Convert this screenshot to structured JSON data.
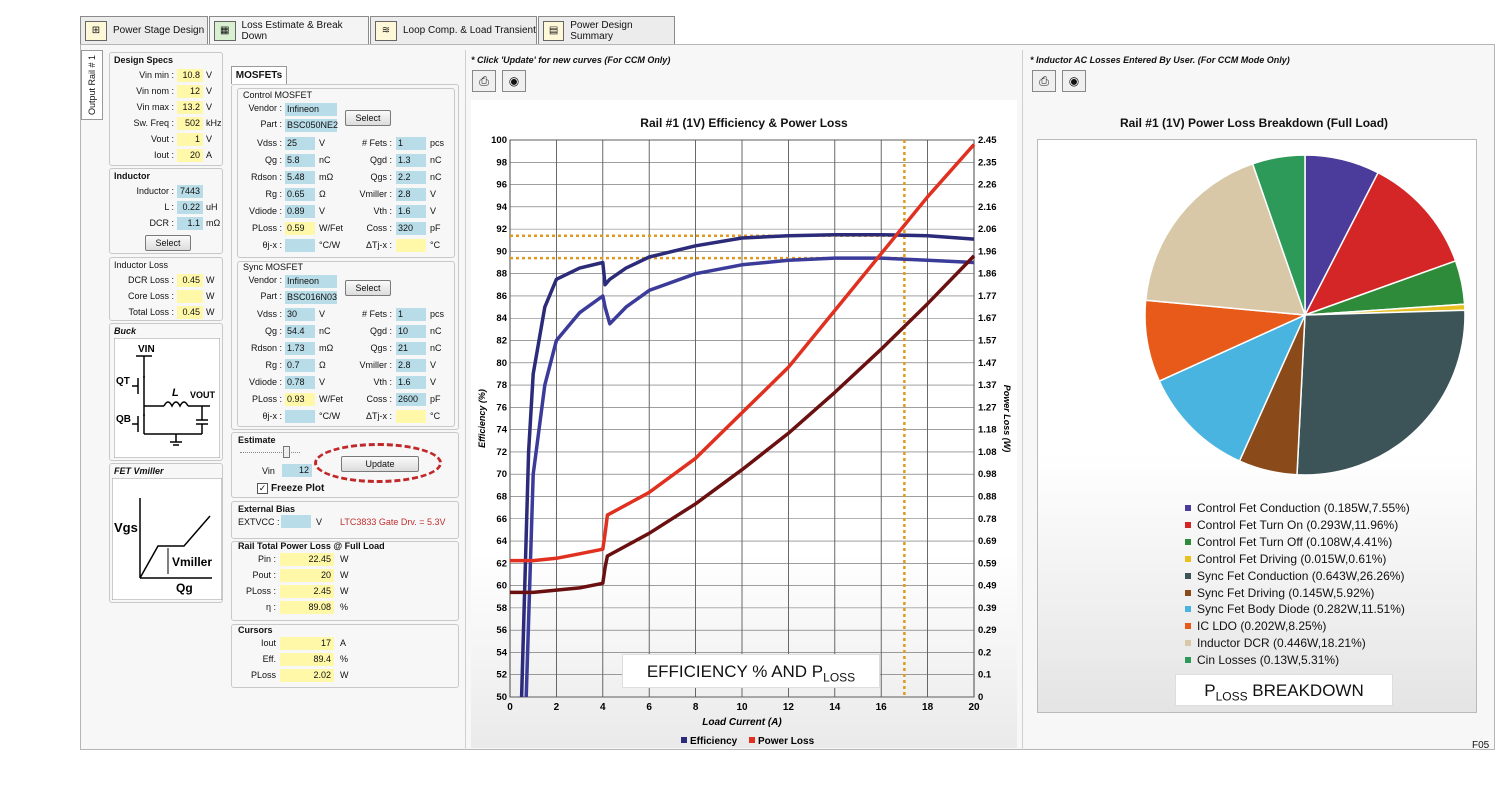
{
  "tabs": [
    {
      "label": "Power Stage Design",
      "icon": "power-stage-icon"
    },
    {
      "label": "Loss Estimate & Break Down",
      "icon": "loss-estimate-icon"
    },
    {
      "label": "Loop Comp. & Load Transient",
      "icon": "loop-comp-icon"
    },
    {
      "label": "Power Design Summary",
      "icon": "summary-icon"
    }
  ],
  "side_tab": "Output Rail # 1",
  "design_specs": {
    "title": "Design Specs",
    "rows": [
      {
        "label": "Vin min :",
        "value": "10.8",
        "unit": "V"
      },
      {
        "label": "Vin nom :",
        "value": "12",
        "unit": "V"
      },
      {
        "label": "Vin max :",
        "value": "13.2",
        "unit": "V"
      },
      {
        "label": "Sw. Freq :",
        "value": "502",
        "unit": "kHz"
      },
      {
        "label": "Vout :",
        "value": "1",
        "unit": "V"
      },
      {
        "label": "Iout :",
        "value": "20",
        "unit": "A"
      }
    ]
  },
  "inductor": {
    "title": "Inductor",
    "rows": [
      {
        "label": "Inductor :",
        "value": "7443",
        "unit": ""
      },
      {
        "label": "L :",
        "value": "0.22",
        "unit": "uH"
      },
      {
        "label": "DCR :",
        "value": "1.1",
        "unit": "mΩ"
      }
    ],
    "select_label": "Select"
  },
  "inductor_loss": {
    "title": "Inductor Loss",
    "rows": [
      {
        "label": "DCR Loss :",
        "value": "0.45",
        "unit": "W"
      },
      {
        "label": "Core Loss :",
        "value": "",
        "unit": "W"
      },
      {
        "label": "Total Loss :",
        "value": "0.45",
        "unit": "W"
      }
    ]
  },
  "buck": {
    "title": "Buck",
    "vin": "VIN",
    "qt": "QT",
    "qb": "QB",
    "l": "L",
    "vout": "VOUT"
  },
  "fet_vmiller": {
    "title": "FET Vmiller",
    "vgs": "Vgs",
    "vmiller": "Vmiller",
    "qg": "Qg"
  },
  "mosfets": {
    "tab_label": "MOSFETs",
    "control": {
      "title": "Control MOSFET",
      "vendor": "Infineon",
      "part": "BSC050NE2",
      "select_label": "Select",
      "vendor_label": "Vendor :",
      "part_label": "Part :",
      "left": [
        {
          "label": "Vdss :",
          "value": "25",
          "unit": "V"
        },
        {
          "label": "Qg :",
          "value": "5.8",
          "unit": "nC"
        },
        {
          "label": "Rdson :",
          "value": "5.48",
          "unit": "mΩ"
        },
        {
          "label": "Rg :",
          "value": "0.65",
          "unit": "Ω"
        },
        {
          "label": "Vdiode :",
          "value": "0.89",
          "unit": "V"
        },
        {
          "label": "PLoss :",
          "value": "0.59",
          "unit": "W/Fet"
        },
        {
          "label": "θj-x :",
          "value": "",
          "unit": "°C/W"
        }
      ],
      "right": [
        {
          "label": "# Fets :",
          "value": "1",
          "unit": "pcs"
        },
        {
          "label": "Qgd :",
          "value": "1.3",
          "unit": "nC"
        },
        {
          "label": "Qgs :",
          "value": "2.2",
          "unit": "nC"
        },
        {
          "label": "Vmiller :",
          "value": "2.8",
          "unit": "V"
        },
        {
          "label": "Vth :",
          "value": "1.6",
          "unit": "V"
        },
        {
          "label": "Coss :",
          "value": "320",
          "unit": "pF"
        },
        {
          "label": "ΔTj-x :",
          "value": "",
          "unit": "°C"
        }
      ]
    },
    "sync": {
      "title": "Sync MOSFET",
      "vendor": "Infineon",
      "part": "BSC016N03",
      "select_label": "Select",
      "vendor_label": "Vendor :",
      "part_label": "Part :",
      "left": [
        {
          "label": "Vdss :",
          "value": "30",
          "unit": "V"
        },
        {
          "label": "Qg :",
          "value": "54.4",
          "unit": "nC"
        },
        {
          "label": "Rdson :",
          "value": "1.73",
          "unit": "mΩ"
        },
        {
          "label": "Rg :",
          "value": "0.7",
          "unit": "Ω"
        },
        {
          "label": "Vdiode :",
          "value": "0.78",
          "unit": "V"
        },
        {
          "label": "PLoss :",
          "value": "0.93",
          "unit": "W/Fet"
        },
        {
          "label": "θj-x :",
          "value": "",
          "unit": "°C/W"
        }
      ],
      "right": [
        {
          "label": "# Fets :",
          "value": "1",
          "unit": "pcs"
        },
        {
          "label": "Qgd :",
          "value": "10",
          "unit": "nC"
        },
        {
          "label": "Qgs :",
          "value": "21",
          "unit": "nC"
        },
        {
          "label": "Vmiller :",
          "value": "2.8",
          "unit": "V"
        },
        {
          "label": "Vth :",
          "value": "1.6",
          "unit": "V"
        },
        {
          "label": "Coss :",
          "value": "2600",
          "unit": "pF"
        },
        {
          "label": "ΔTj-x :",
          "value": "",
          "unit": "°C"
        }
      ]
    }
  },
  "estimate": {
    "title": "Estimate",
    "vin_label": "Vin",
    "vin_value": "12",
    "update_label": "Update",
    "freeze_label": "Freeze Plot",
    "freeze_checked": true
  },
  "external_bias": {
    "title": "External Bias",
    "extvcc_label": "EXTVCC :",
    "extvcc_value": "",
    "unit": "V",
    "note": "LTC3833 Gate Drv. = 5.3V"
  },
  "rail_total": {
    "title": "Rail Total Power Loss @ Full Load",
    "rows": [
      {
        "label": "Pin :",
        "value": "22.45",
        "unit": "W"
      },
      {
        "label": "Pout :",
        "value": "20",
        "unit": "W"
      },
      {
        "label": "PLoss :",
        "value": "2.45",
        "unit": "W"
      },
      {
        "label": "η :",
        "value": "89.08",
        "unit": "%"
      }
    ]
  },
  "cursors": {
    "title": "Cursors",
    "rows": [
      {
        "label": "Iout",
        "value": "17",
        "unit": "A"
      },
      {
        "label": "Eff.",
        "value": "89.4",
        "unit": "%"
      },
      {
        "label": "PLoss",
        "value": "2.02",
        "unit": "W"
      }
    ]
  },
  "efficiency_panel": {
    "note": "* Click 'Update' for new curves (For CCM Only)",
    "caption_main": "EFFICIENCY % AND P",
    "caption_sub": "LOSS",
    "print_icon": "printer-icon",
    "camera_icon": "camera-icon"
  },
  "pie_panel": {
    "note": "* Inductor AC Losses Entered By User. (For CCM Mode Only)",
    "caption_pre": "P",
    "caption_sub": "LOSS",
    "caption_post": " BREAKDOWN"
  },
  "footer_code": "F05",
  "chart_data": [
    {
      "type": "line",
      "title": "Rail #1 (1V) Efficiency & Power Loss",
      "xlabel": "Load Current (A)",
      "ylabel": "Efficiency (%)",
      "y2label": "Power Loss (W)",
      "xlim": [
        0,
        20
      ],
      "ylim": [
        50,
        100
      ],
      "y2lim": [
        0,
        2.45
      ],
      "xticks": [
        "0",
        "2",
        "4",
        "6",
        "8",
        "10",
        "12",
        "14",
        "16",
        "18",
        "20"
      ],
      "yticks": [
        "50",
        "52",
        "54",
        "56",
        "58",
        "60",
        "62",
        "64",
        "66",
        "68",
        "70",
        "72",
        "74",
        "76",
        "78",
        "80",
        "82",
        "84",
        "86",
        "88",
        "90",
        "92",
        "94",
        "96",
        "98",
        "100"
      ],
      "y2ticks": [
        "0",
        "0.1",
        "0.2",
        "0.29",
        "0.39",
        "0.49",
        "0.59",
        "0.69",
        "0.78",
        "0.88",
        "0.98",
        "1.08",
        "1.18",
        "1.27",
        "1.37",
        "1.47",
        "1.57",
        "1.67",
        "1.77",
        "1.86",
        "1.96",
        "2.06",
        "2.16",
        "2.26",
        "2.35",
        "2.45"
      ],
      "series": [
        {
          "name": "Efficiency",
          "axis": "left",
          "color": "#2b2b7a",
          "x": [
            0.5,
            0.8,
            1,
            1.5,
            2,
            3,
            4,
            4.1,
            4.3,
            5,
            6,
            8,
            10,
            12,
            14,
            16,
            18,
            20
          ],
          "y": [
            50,
            72,
            79,
            85,
            87.5,
            88.5,
            89,
            87,
            87.5,
            88.5,
            89.5,
            90.5,
            91.2,
            91.4,
            91.5,
            91.5,
            91.4,
            91.1
          ]
        },
        {
          "name": "",
          "axis": "left",
          "color": "#3b3b9a",
          "x": [
            0.7,
            1,
            1.5,
            2,
            3,
            4,
            4.1,
            4.3,
            5,
            6,
            8,
            10,
            12,
            14,
            16,
            18,
            20
          ],
          "y": [
            50,
            70,
            78,
            82,
            84.5,
            86,
            85,
            83.5,
            85,
            86.5,
            88,
            88.8,
            89.2,
            89.4,
            89.4,
            89.2,
            89
          ]
        },
        {
          "name": "Power Loss",
          "axis": "right",
          "color": "#e03020",
          "x": [
            0,
            1,
            2,
            3,
            4,
            4.1,
            4.2,
            6,
            8,
            10,
            12,
            14,
            16,
            18,
            20
          ],
          "y": [
            0.6,
            0.6,
            0.61,
            0.63,
            0.65,
            0.72,
            0.8,
            0.9,
            1.05,
            1.25,
            1.45,
            1.7,
            1.95,
            2.2,
            2.43
          ]
        },
        {
          "name": "",
          "axis": "right",
          "color": "#6a1010",
          "x": [
            0,
            1,
            2,
            3,
            4,
            4.1,
            4.2,
            6,
            8,
            10,
            12,
            14,
            16,
            18,
            20
          ],
          "y": [
            0.46,
            0.46,
            0.47,
            0.48,
            0.5,
            0.57,
            0.62,
            0.72,
            0.85,
            1.0,
            1.16,
            1.34,
            1.53,
            1.73,
            1.94
          ]
        }
      ],
      "cursor_x": 17,
      "cursor_eff": [
        91.4,
        89.4
      ],
      "legend_placement": "bottom",
      "grid": true
    },
    {
      "type": "pie",
      "title": "Rail #1 (1V) Power Loss Breakdown (Full Load)",
      "slices": [
        {
          "label": "Control Fet Conduction (0.185W,7.55%)",
          "value": 7.55,
          "color": "#4b3b9a"
        },
        {
          "label": "Control Fet Turn On (0.293W,11.96%)",
          "value": 11.96,
          "color": "#d42626"
        },
        {
          "label": "Control Fet Turn Off (0.108W,4.41%)",
          "value": 4.41,
          "color": "#2e8b3a"
        },
        {
          "label": "Control Fet Driving (0.015W,0.61%)",
          "value": 0.61,
          "color": "#e8c020"
        },
        {
          "label": "Sync Fet Conduction (0.643W,26.26%)",
          "value": 26.26,
          "color": "#3c5457"
        },
        {
          "label": "Sync Fet Driving (0.145W,5.92%)",
          "value": 5.92,
          "color": "#8a4a1a"
        },
        {
          "label": "Sync Fet Body Diode (0.282W,11.51%)",
          "value": 11.51,
          "color": "#4ab4e0"
        },
        {
          "label": "IC LDO (0.202W,8.25%)",
          "value": 8.25,
          "color": "#e85a1a"
        },
        {
          "label": "Inductor DCR (0.446W,18.21%)",
          "value": 18.21,
          "color": "#d8c8a8"
        },
        {
          "label": "Cin Losses (0.13W,5.31%)",
          "value": 5.31,
          "color": "#2e9a5a"
        }
      ],
      "legend_placement": "bottom"
    }
  ]
}
